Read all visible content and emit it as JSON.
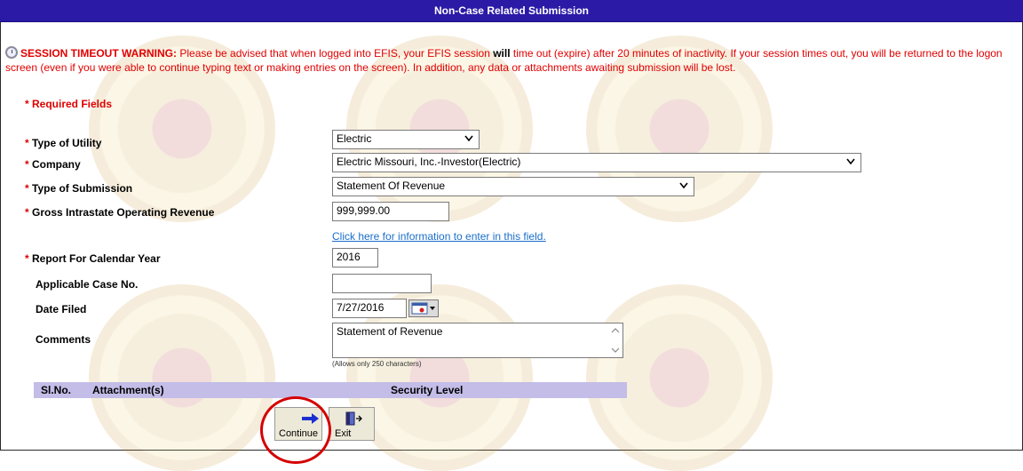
{
  "title": "Non-Case Related Submission",
  "warning": {
    "lead": "SESSION TIMEOUT WARNING:",
    "text_a": " Please be advised that when logged into EFIS, your EFIS session ",
    "emph": "will",
    "text_b": " time out (expire) after 20 minutes of inactivity. If your session times out, you will be returned to the logon screen (even if you were able to continue typing text or making entries on the screen). In addition, any data or attachments awaiting submission will be lost."
  },
  "required_note": "* Required Fields",
  "fields": {
    "utility": {
      "label": "Type of Utility",
      "value": "Electric"
    },
    "company": {
      "label": "Company",
      "value": "Electric Missouri, Inc.-Investor(Electric)"
    },
    "submission": {
      "label": "Type of Submission",
      "value": "Statement Of Revenue"
    },
    "revenue": {
      "label": "Gross Intrastate Operating Revenue",
      "value": "999,999.00"
    },
    "revenue_link": "Click here for information to enter in this field.",
    "year": {
      "label": "Report For Calendar Year",
      "value": "2016"
    },
    "case_no": {
      "label": "Applicable Case No.",
      "value": ""
    },
    "date_filed": {
      "label": "Date Filed",
      "value": "7/27/2016"
    },
    "comments": {
      "label": "Comments",
      "value": "Statement of Revenue"
    },
    "comments_note": "(Allows only 250 characters)"
  },
  "req_marker": "*",
  "attachments": {
    "col_sl": "Sl.No.",
    "col_attach": "Attachment(s)",
    "col_security": "Security Level"
  },
  "buttons": {
    "continue": "Continue",
    "exit": "Exit"
  },
  "colors": {
    "title_bg": "#2b1aa6",
    "warning": "#e00000",
    "link": "#1a6ecc",
    "attach_header": "#c3bde8",
    "highlight_circle": "#d40000"
  }
}
